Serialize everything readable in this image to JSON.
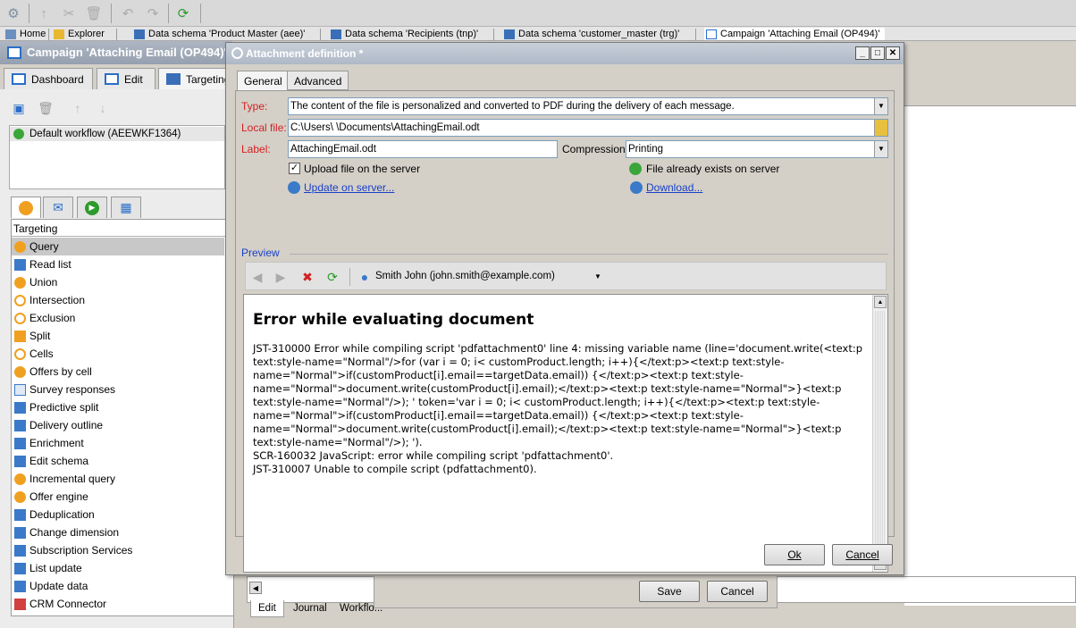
{
  "tabstrip": {
    "tabs": [
      "Home",
      "Explorer",
      "Data schema 'Product Master (aee)'",
      "Data schema 'Recipients (tnp)'",
      "Data schema 'customer_master (trg)'",
      "Campaign 'Attaching Email (OP494)'"
    ]
  },
  "campaign": {
    "title": "Campaign 'Attaching Email (OP494)'"
  },
  "main_tabs": {
    "dashboard": "Dashboard",
    "edit": "Edit",
    "targeting": "Targeting"
  },
  "workflow": {
    "item": "Default workflow (AEEWKF1364)"
  },
  "palette": {
    "header": "Targeting",
    "items": [
      "Query",
      "Read list",
      "Union",
      "Intersection",
      "Exclusion",
      "Split",
      "Cells",
      "Offers by cell",
      "Survey responses",
      "Predictive split",
      "Delivery outline",
      "Enrichment",
      "Edit schema",
      "Incremental query",
      "Offer engine",
      "Deduplication",
      "Change dimension",
      "Subscription Services",
      "List update",
      "Update data",
      "CRM Connector"
    ]
  },
  "bottom_tabs": {
    "edit": "Edit",
    "journal": "Journal",
    "workflow": "Workflo..."
  },
  "outer_buttons": {
    "save": "Save",
    "cancel": "Cancel"
  },
  "dialog": {
    "title": "Attachment definition *",
    "tabs": {
      "general": "General",
      "advanced": "Advanced"
    },
    "type_label": "Type:",
    "type_value": "The content of the file is personalized and converted to PDF during the delivery of each message.",
    "local_file_label": "Local file:",
    "local_file_value": "C:\\Users\\ \\Documents\\AttachingEmail.odt",
    "label_label": "Label:",
    "label_value": "AttachingEmail.odt",
    "compression_label": "Compression:",
    "compression_value": "Printing",
    "upload_checkbox": "Upload file on the server",
    "file_exists": "File already exists on server",
    "update_link": "Update on server...",
    "download_link": "Download...",
    "preview_label": "Preview",
    "recipient": "Smith John (john.smith@example.com)",
    "doc_title": "Error while evaluating document",
    "doc_lines": [
      "JST-310000 Error while compiling script 'pdfattachment0' line 4: missing variable name (line='document.write(<text:p",
      "text:style-name=\"Normal\"/>for (var i = 0; i< customProduct.length; i++){</text:p><text:p text:style-",
      "name=\"Normal\">if(customProduct[i].email==targetData.email)) {</text:p><text:p text:style-",
      "name=\"Normal\">document.write(customProduct[i].email);</text:p><text:p text:style-name=\"Normal\">}<text:p",
      "text:style-name=\"Normal\"/>); ' token='var i = 0; i< customProduct.length; i++){</text:p><text:p text:style-",
      "name=\"Normal\">if(customProduct[i].email==targetData.email)) {</text:p><text:p text:style-",
      "name=\"Normal\">document.write(customProduct[i].email);</text:p><text:p text:style-name=\"Normal\">}<text:p",
      "text:style-name=\"Normal\"/>); ').",
      "SCR-160032 JavaScript: error while compiling script 'pdfattachment0'.",
      "JST-310007 Unable to compile script (pdfattachment0)."
    ],
    "ok": "Ok",
    "cancel": "Cancel"
  }
}
